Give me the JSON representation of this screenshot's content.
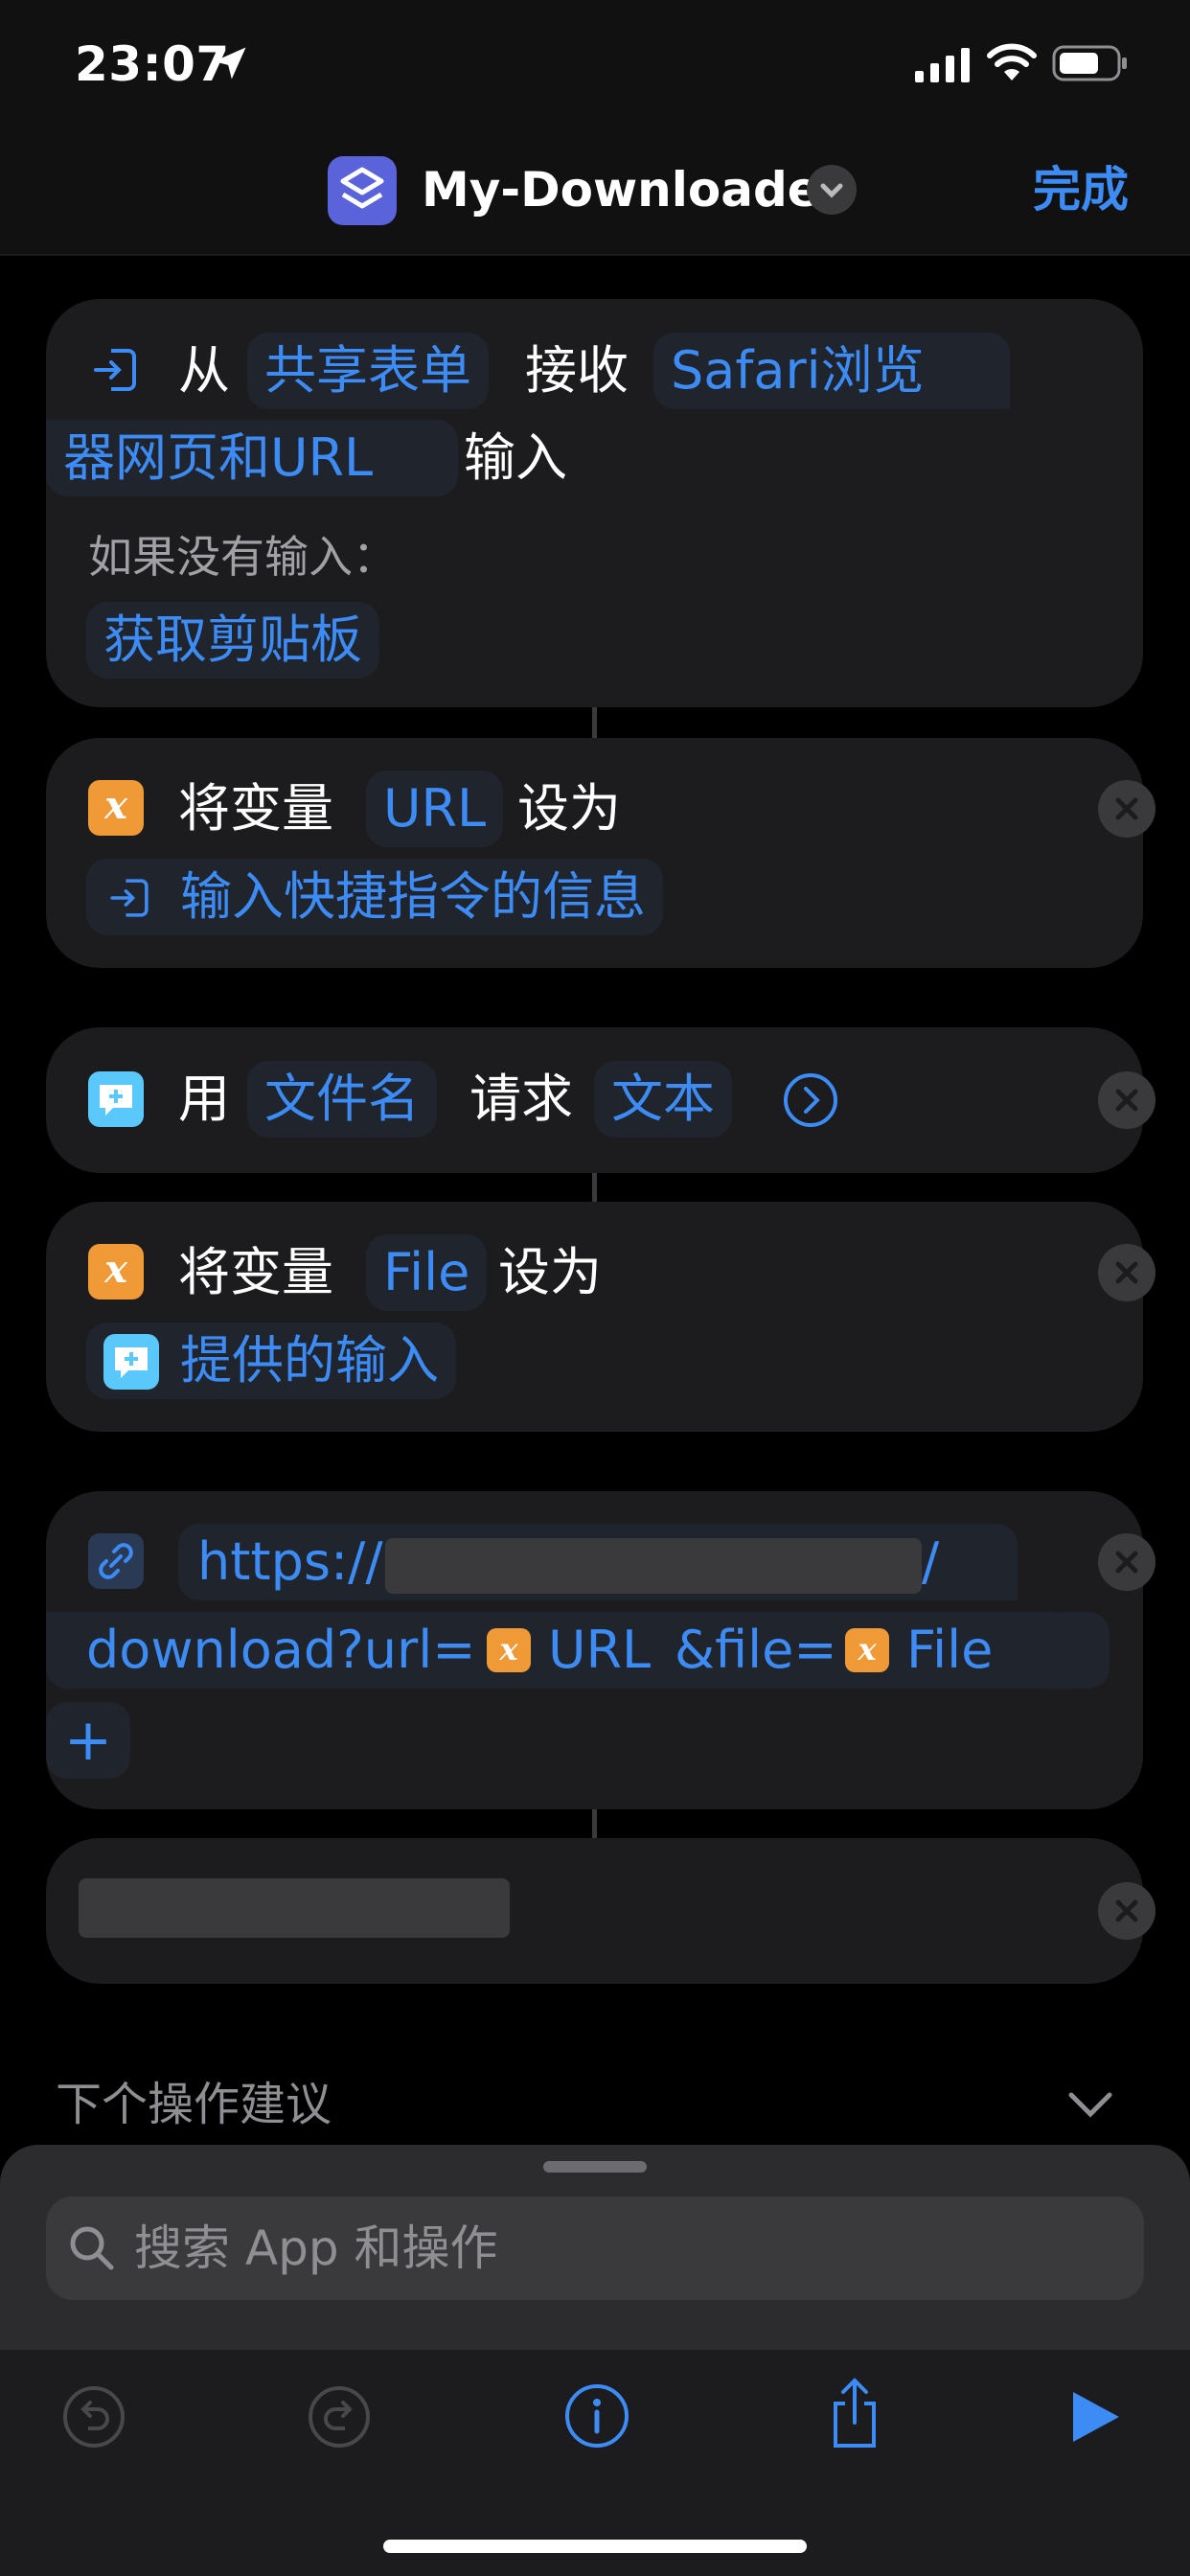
{
  "status_bar": {
    "time": "23:07"
  },
  "nav": {
    "title": "My-Downloader",
    "done_label": "完成"
  },
  "actions": {
    "receive": {
      "from_label": "从",
      "source_token": "共享表单",
      "receive_label": "接收",
      "types_token_line1": "Safari浏览",
      "types_token_line2": "器网页和URL",
      "input_label": "输入",
      "no_input_label": "如果没有输入：",
      "fallback_token": "获取剪贴板"
    },
    "set_url": {
      "prefix": "将变量",
      "var_token": "URL",
      "suffix": "设为",
      "value_token": "输入快捷指令的信息"
    },
    "ask": {
      "prefix": "用",
      "prompt_token": "文件名",
      "mid": "请求",
      "type_token": "文本"
    },
    "set_file": {
      "prefix": "将变量",
      "var_token": "File",
      "suffix": "设为",
      "value_token": "提供的输入"
    },
    "url_action": {
      "line1_prefix": "https://",
      "line1_suffix": "/",
      "line2_part1": "download?url=",
      "var1": "URL",
      "line2_part2": "&file=",
      "var2": "File",
      "add_label": "+"
    }
  },
  "suggestions": {
    "label": "下个操作建议"
  },
  "search": {
    "placeholder": "搜索 App 和操作"
  },
  "colors": {
    "accent": "#3d8cf5",
    "variable": "#f09a37",
    "card": "#1c1c1e"
  }
}
